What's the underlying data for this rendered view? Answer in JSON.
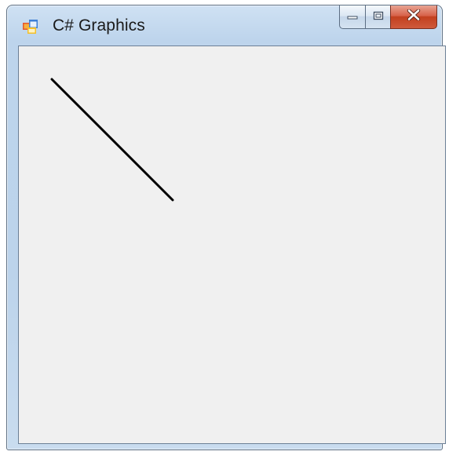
{
  "window": {
    "title": "C# Graphics",
    "icon": "application-form-icon",
    "caption_buttons": [
      {
        "name": "minimize-button",
        "icon": "minimize-icon"
      },
      {
        "name": "maximize-button",
        "icon": "maximize-icon"
      },
      {
        "name": "close-button",
        "icon": "close-x-icon"
      }
    ]
  },
  "client_area": {
    "background": "#f0f0f0",
    "shapes": [
      {
        "type": "line",
        "color": "#000000"
      }
    ]
  }
}
